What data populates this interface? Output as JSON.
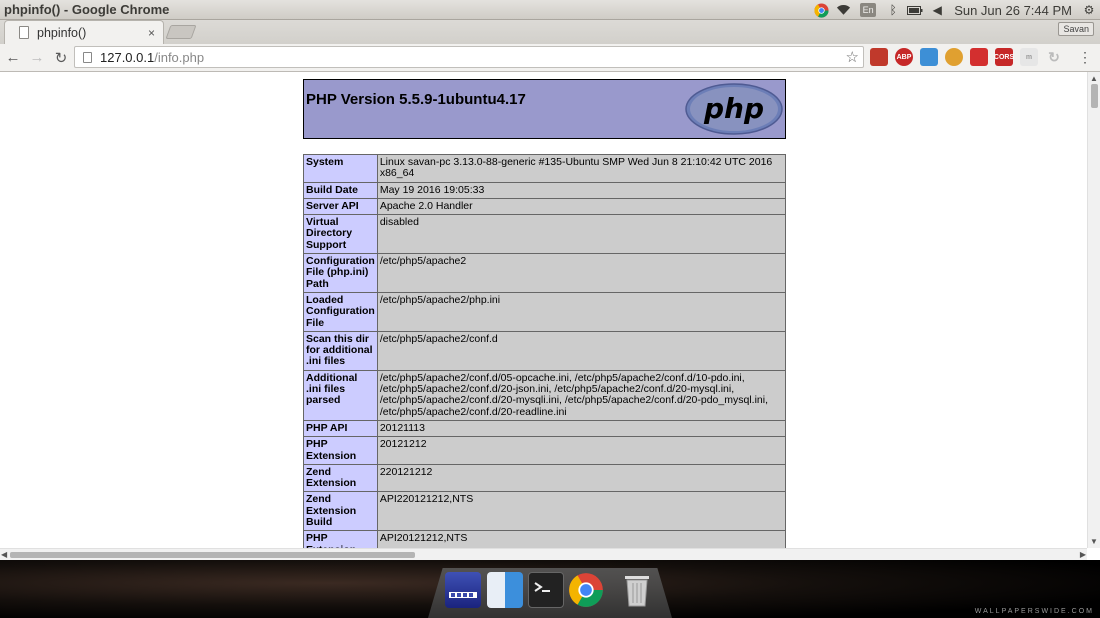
{
  "os": {
    "window_title": "phpinfo() - Google Chrome",
    "lang_indicator": "En",
    "clock": "Sun Jun 26  7:44 PM"
  },
  "browser": {
    "tab_title": "phpinfo()",
    "tab_close": "×",
    "profile_name": "Savan",
    "url_host": "127.0.0.1",
    "url_path": "/info.php",
    "extensions": [
      "bookmark-icon",
      "adblock-icon",
      "extension-icon",
      "cookie-icon",
      "stack-icon",
      "cors-icon",
      "m-icon",
      "refresh-ext-icon"
    ],
    "ext_adblock_label": "ABP",
    "ext_cors_label": "CORS"
  },
  "page": {
    "php_version_title": "PHP Version 5.5.9-1ubuntu4.17",
    "logo_text": "php",
    "rows": [
      {
        "k": "System",
        "v": "Linux savan-pc 3.13.0-88-generic #135-Ubuntu SMP Wed Jun 8 21:10:42 UTC 2016 x86_64"
      },
      {
        "k": "Build Date",
        "v": "May 19 2016 19:05:33"
      },
      {
        "k": "Server API",
        "v": "Apache 2.0 Handler"
      },
      {
        "k": "Virtual Directory Support",
        "v": "disabled"
      },
      {
        "k": "Configuration File (php.ini) Path",
        "v": "/etc/php5/apache2"
      },
      {
        "k": "Loaded Configuration File",
        "v": "/etc/php5/apache2/php.ini"
      },
      {
        "k": "Scan this dir for additional .ini files",
        "v": "/etc/php5/apache2/conf.d"
      },
      {
        "k": "Additional .ini files parsed",
        "v": "/etc/php5/apache2/conf.d/05-opcache.ini, /etc/php5/apache2/conf.d/10-pdo.ini, /etc/php5/apache2/conf.d/20-json.ini, /etc/php5/apache2/conf.d/20-mysql.ini, /etc/php5/apache2/conf.d/20-mysqli.ini, /etc/php5/apache2/conf.d/20-pdo_mysql.ini, /etc/php5/apache2/conf.d/20-readline.ini"
      },
      {
        "k": "PHP API",
        "v": "20121113"
      },
      {
        "k": "PHP Extension",
        "v": "20121212"
      },
      {
        "k": "Zend Extension",
        "v": "220121212"
      },
      {
        "k": "Zend Extension Build",
        "v": "API220121212,NTS"
      },
      {
        "k": "PHP Extension Build",
        "v": "API20121212,NTS"
      }
    ]
  },
  "desktop": {
    "dock_apps": [
      "workspace-switcher-icon",
      "finder-icon",
      "terminal-icon",
      "chrome-icon",
      "trash-icon"
    ],
    "watermark": "WALLPAPERSWIDE.COM"
  }
}
